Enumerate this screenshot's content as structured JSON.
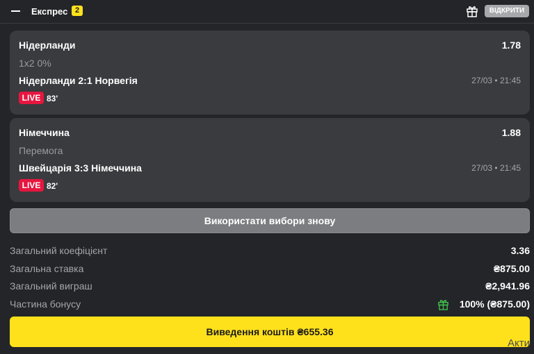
{
  "header": {
    "title": "Експрес",
    "count": "2",
    "open_label": "ВІДКРИТИ",
    "collapse_icon": "minus-icon",
    "gift_icon": "gift-icon"
  },
  "bets": [
    {
      "selection": "Нідерланди",
      "odds": "1.78",
      "market": "1x2 0%",
      "match": "Нідерланди 2:1 Норвегія",
      "time": "27/03 • 21:45",
      "live": "LIVE",
      "minute": "83'"
    },
    {
      "selection": "Німеччина",
      "odds": "1.88",
      "market": "Перемога",
      "match": "Швейцарія 3:3 Німеччина",
      "time": "27/03 • 21:45",
      "live": "LIVE",
      "minute": "82'"
    }
  ],
  "reuse_label": "Використати вибори знову",
  "summary": {
    "total_odds_label": "Загальний коефіцієнт",
    "total_odds_value": "3.36",
    "total_stake_label": "Загальна ставка",
    "total_stake_value": "₴875.00",
    "total_win_label": "Загальний виграш",
    "total_win_value": "₴2,941.96",
    "bonus_label": "Частина бонусу",
    "bonus_value": "100% (₴875.00)"
  },
  "cashout_label": "Виведення коштів ₴655.36",
  "watermark": "Акти",
  "colors": {
    "background": "#232529",
    "card": "#3a3b3f",
    "accent": "#ffe11b",
    "live": "#e6163f",
    "gift_green": "#3fbf4a"
  }
}
